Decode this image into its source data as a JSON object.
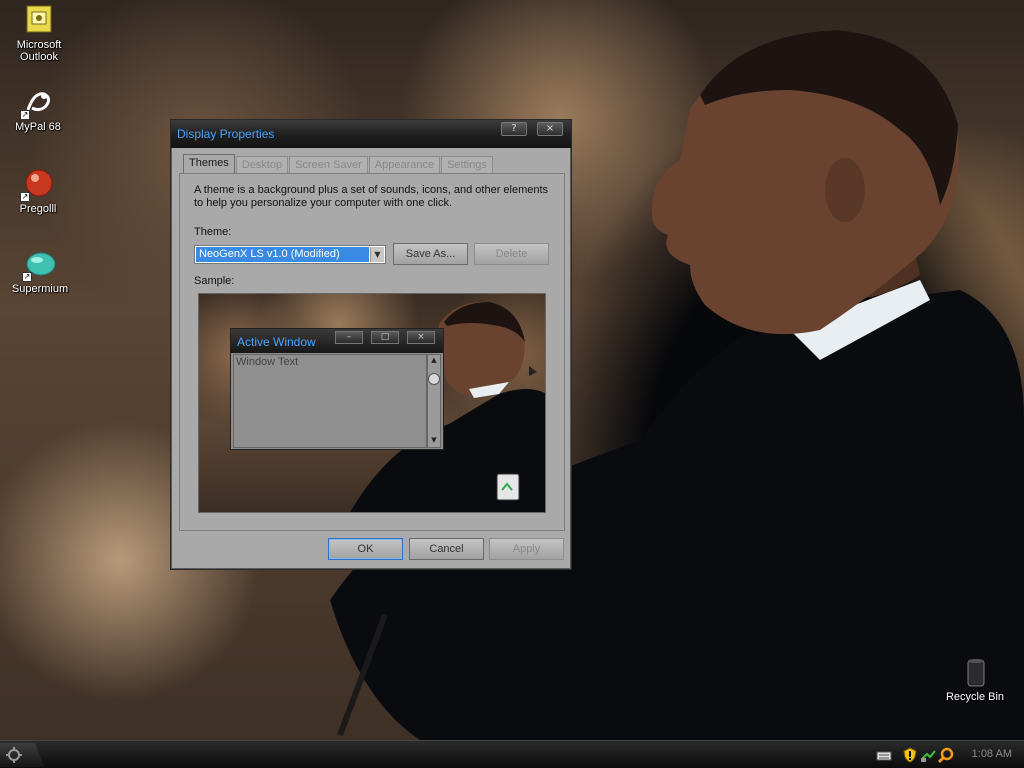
{
  "desktop": {
    "icons": [
      {
        "label_line1": "Microsoft",
        "label_line2": "Outlook"
      },
      {
        "label_line1": "MyPal 68",
        "label_line2": ""
      },
      {
        "label_line1": "Pregolll",
        "label_line2": ""
      },
      {
        "label_line1": "Supermium",
        "label_line2": ""
      }
    ],
    "recycle_bin": "Recycle Bin"
  },
  "dialog": {
    "title": "Display Properties",
    "help_button": "?",
    "close_button": "×",
    "tabs": [
      "Themes",
      "Desktop",
      "Screen Saver",
      "Appearance",
      "Settings"
    ],
    "active_tab": "Themes",
    "description": "A theme is a background plus a set of sounds, icons, and other elements to help you personalize your computer with one click.",
    "theme_label": "Theme:",
    "theme_value": "NeoGenX LS v1.0 (Modified)",
    "save_as": "Save As...",
    "delete": "Delete",
    "sample_label": "Sample:",
    "preview": {
      "window_title": "Active Window",
      "window_text": "Window Text",
      "min_btn": "–",
      "max_btn": "□",
      "close_btn": "×"
    },
    "ok": "OK",
    "cancel": "Cancel",
    "apply": "Apply"
  },
  "taskbar": {
    "clock": "1:08 AM"
  },
  "colors": {
    "title_text": "#4aa3ff",
    "selection": "#3a89e3"
  }
}
